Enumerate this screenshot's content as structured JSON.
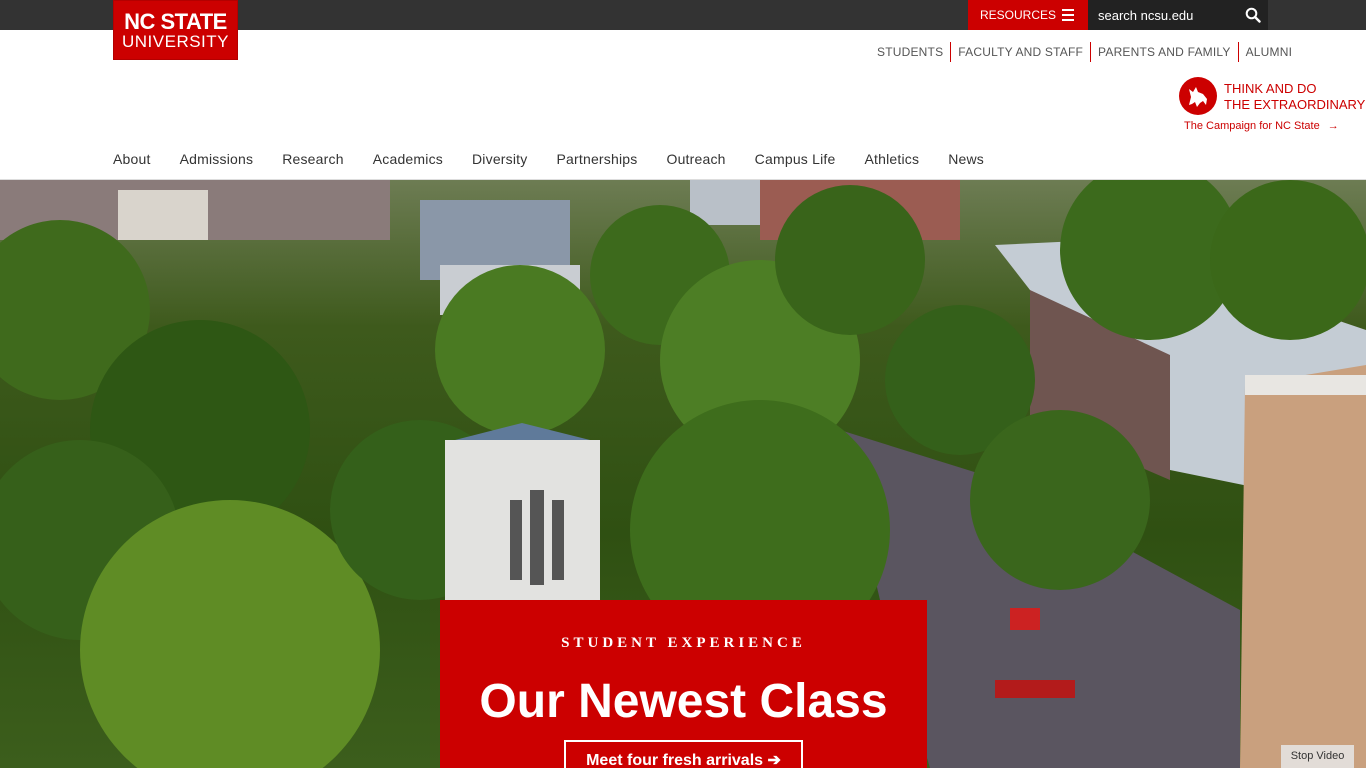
{
  "logo": {
    "line1": "NC STATE",
    "line2": "UNIVERSITY"
  },
  "utility": {
    "resources_label": "RESOURCES",
    "search_placeholder": "search ncsu.edu"
  },
  "audience_links": [
    "STUDENTS",
    "FACULTY AND STAFF",
    "PARENTS AND FAMILY",
    "ALUMNI"
  ],
  "campaign": {
    "line1": "THINK AND DO",
    "line2": "THE EXTRAORDINARY",
    "link": "The Campaign for NC State"
  },
  "main_nav": [
    "About",
    "Admissions",
    "Research",
    "Academics",
    "Diversity",
    "Partnerships",
    "Outreach",
    "Campus Life",
    "Athletics",
    "News"
  ],
  "hero": {
    "kicker": "STUDENT EXPERIENCE",
    "title": "Our Newest Class",
    "cta": "Meet four fresh arrivals ➔",
    "stop_video": "Stop Video"
  },
  "colors": {
    "brand_red": "#cc0000",
    "utility_bar": "#333333"
  }
}
